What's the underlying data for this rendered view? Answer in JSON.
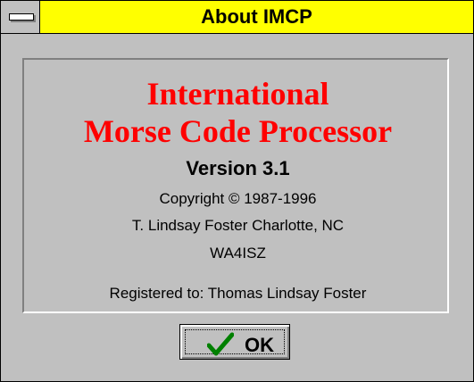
{
  "window": {
    "title": "About IMCP"
  },
  "about": {
    "title_line1": "International",
    "title_line2": "Morse Code Processor",
    "version": "Version 3.1",
    "copyright": "Copyright © 1987-1996",
    "author": "T. Lindsay Foster  Charlotte, NC",
    "callsign": "WA4ISZ",
    "registered": "Registered to:  Thomas Lindsay Foster"
  },
  "buttons": {
    "ok_label": "OK"
  },
  "icons": {
    "system_menu": "system-menu-icon",
    "ok_check": "checkmark-icon"
  },
  "colors": {
    "titlebar": "#ffff00",
    "title_text": "#ff0000",
    "face": "#c0c0c0",
    "checkmark": "#008000"
  }
}
